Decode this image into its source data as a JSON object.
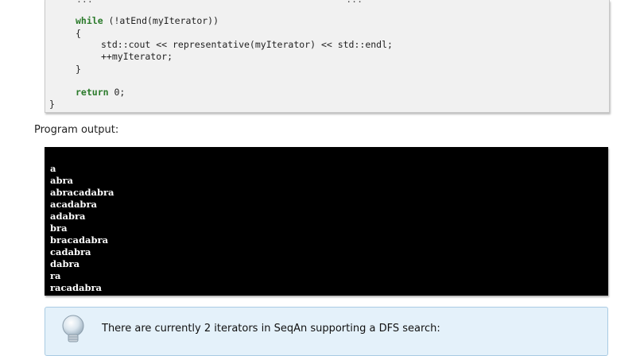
{
  "code": {
    "cut_line": "...                                              ...",
    "while_keyword": "while",
    "while_rest": " (!atEnd(myIterator))",
    "open_brace": "{",
    "line_cout": "std::cout << representative(myIterator) << std::endl;",
    "line_incr": "++myIterator;",
    "close_brace": "}",
    "return_keyword": "return",
    "return_rest": " 0;",
    "outer_close_brace": "}"
  },
  "section_label": "Program output:",
  "output_lines": [
    "a",
    "abra",
    "abracadabra",
    "acadabra",
    "adabra",
    "bra",
    "bracadabra",
    "cadabra",
    "dabra",
    "ra",
    "racadabra"
  ],
  "note": {
    "icon": "lightbulb-icon",
    "text": "There are currently 2 iterators in SeqAn supporting a DFS search:"
  }
}
